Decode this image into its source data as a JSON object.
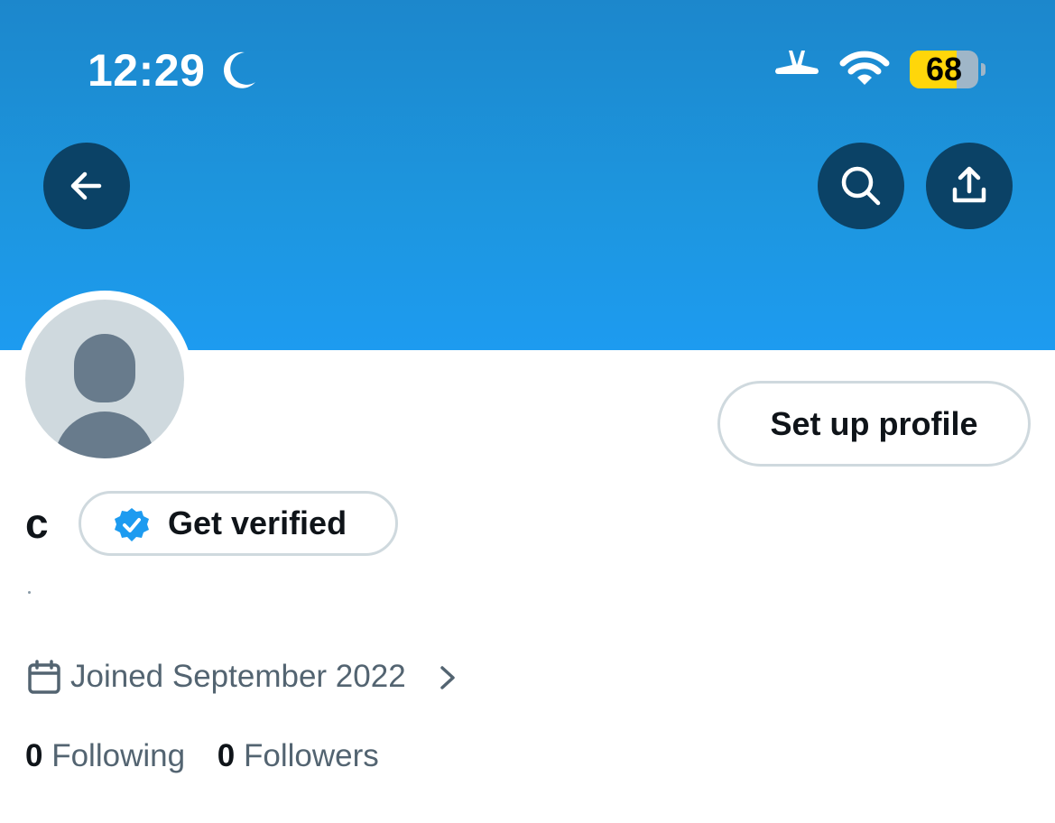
{
  "status_bar": {
    "time": "12:29",
    "battery": "68",
    "battery_level": 0.68,
    "icons": [
      "moon-icon",
      "airplane-icon",
      "wifi-icon",
      "battery-icon"
    ]
  },
  "header": {
    "icons": [
      "back-arrow-icon",
      "search-icon",
      "share-icon"
    ]
  },
  "profile": {
    "setup_button": "Set up profile",
    "name": "c",
    "verify_button": "Get verified",
    "bio": ".",
    "joined": "Joined September 2022",
    "following_count": "0",
    "following_label": "Following",
    "followers_count": "0",
    "followers_label": "Followers"
  },
  "colors": {
    "banner": "#1d9bf0",
    "header_button": "#0b4266",
    "verified_badge": "#1d9bf0",
    "battery": "#ffd60a"
  }
}
